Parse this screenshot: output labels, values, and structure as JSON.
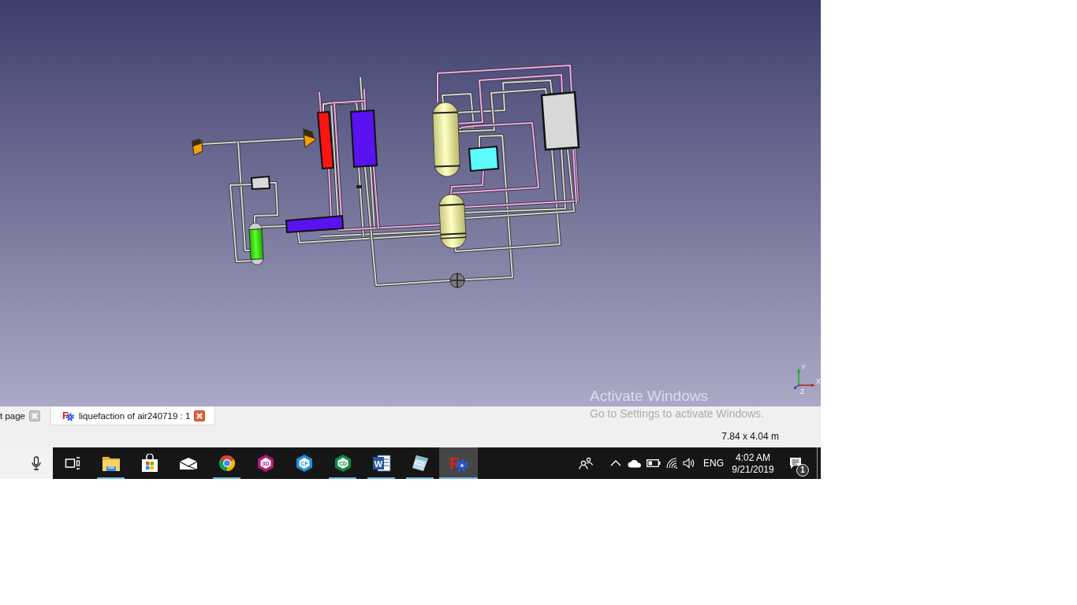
{
  "viewport": {
    "axis_labels": [
      {
        "kind": "y",
        "text": "Y"
      },
      {
        "kind": "z",
        "text": "Z"
      },
      {
        "kind": "x",
        "text": "X"
      }
    ]
  },
  "activation_notice": {
    "title": "Activate Windows",
    "message": "Go to Settings to activate Windows."
  },
  "tabs": [
    {
      "label": "t page",
      "selected": false
    },
    {
      "label": "liquefaction of air240719 : 1",
      "icon_glyph": "F",
      "selected": true
    }
  ],
  "status_bar": {
    "dimensions": "7.84 x 4.04 m"
  },
  "taskbar": {
    "apps": [
      {
        "kind": "task-view",
        "running": false,
        "selected": false
      },
      {
        "kind": "file-explorer",
        "running": true,
        "selected": false
      },
      {
        "kind": "store",
        "running": false,
        "selected": false
      },
      {
        "kind": "mail",
        "running": false,
        "selected": false
      },
      {
        "kind": "browser",
        "running": true,
        "selected": false
      },
      {
        "kind": "hex-3d",
        "glyph": "3D",
        "running": false,
        "selected": false
      },
      {
        "kind": "hex-cf",
        "glyph": "CF",
        "running": false,
        "selected": false
      },
      {
        "kind": "hex-cd",
        "glyph": "CD",
        "running": true,
        "selected": false
      },
      {
        "kind": "word",
        "glyph": "W",
        "running": true,
        "selected": false
      },
      {
        "kind": "notepad",
        "running": true,
        "selected": false
      },
      {
        "kind": "freecad",
        "glyph": "F",
        "running": true,
        "selected": true
      }
    ],
    "language": "ENG",
    "time": "4:02 AM",
    "date": "9/21/2019",
    "notification_count": "1"
  }
}
